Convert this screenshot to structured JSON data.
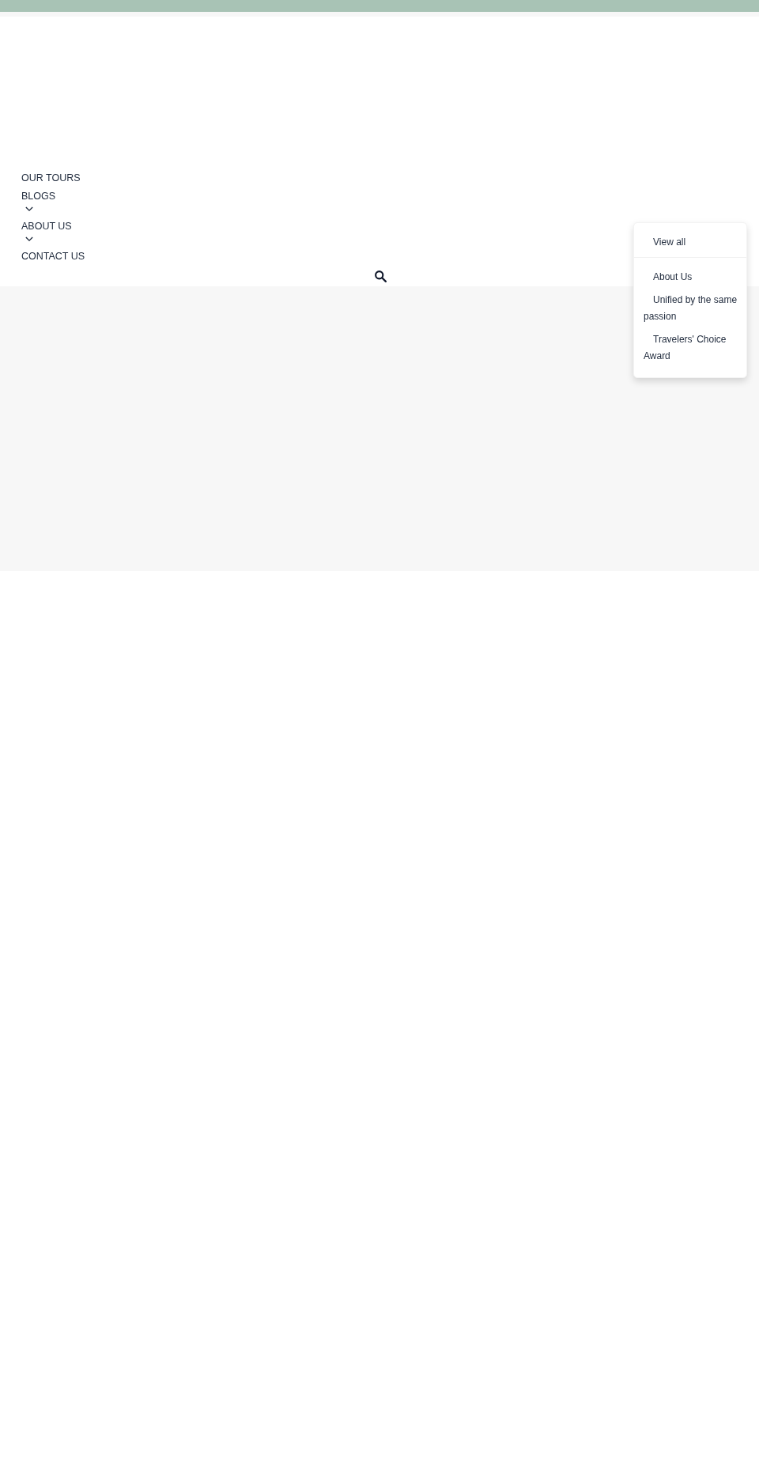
{
  "nav": {
    "items": [
      {
        "label": "OUR TOURS",
        "has_submenu": false
      },
      {
        "label": "BLOGS",
        "has_submenu": true
      },
      {
        "label": "ABOUT US",
        "has_submenu": true
      },
      {
        "label": "CONTACT US",
        "has_submenu": false
      }
    ]
  },
  "dropdown": {
    "header": "View all",
    "items": [
      {
        "label": "About Us"
      },
      {
        "label": "Unified by the same passion"
      },
      {
        "label": "Travelers' Choice Award"
      }
    ]
  }
}
